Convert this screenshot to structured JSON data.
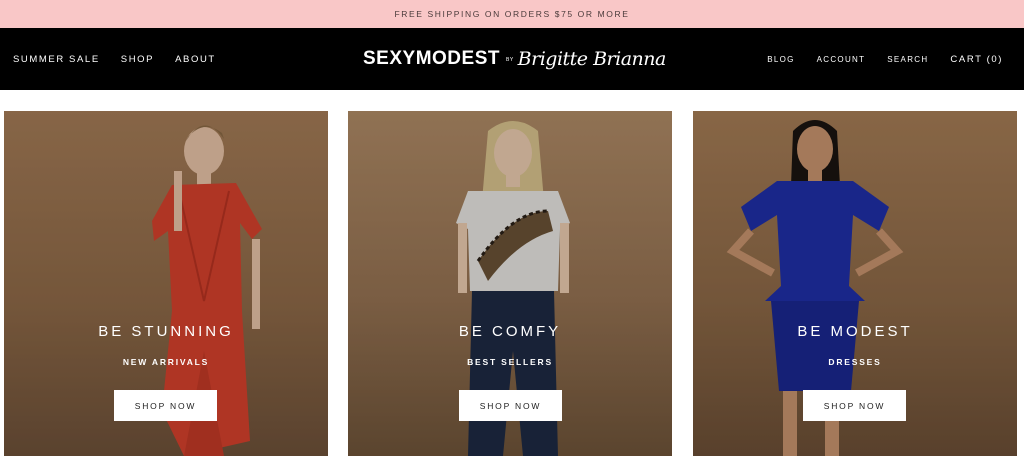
{
  "announcement": "FREE SHIPPING ON ORDERS $75 OR MORE",
  "nav_left": [
    {
      "label": "SUMMER SALE"
    },
    {
      "label": "SHOP"
    },
    {
      "label": "ABOUT"
    }
  ],
  "logo": {
    "wordmark": "SEXYMODEST",
    "by": "BY",
    "script": "Brigitte Brianna"
  },
  "nav_right": [
    {
      "label": "BLOG"
    },
    {
      "label": "ACCOUNT"
    },
    {
      "label": "SEARCH"
    },
    {
      "label": "CART (0)"
    }
  ],
  "cards": [
    {
      "title": "BE STUNNING",
      "subtitle": "NEW ARRIVALS",
      "button": "SHOP NOW",
      "garment_color": "#d6412d"
    },
    {
      "title": "BE COMFY",
      "subtitle": "BEST SELLERS",
      "button": "SHOP NOW",
      "garment_color": "#e8e6e2"
    },
    {
      "title": "BE MODEST",
      "subtitle": "DRESSES",
      "button": "SHOP NOW",
      "garment_color": "#1f2fa8"
    }
  ],
  "colors": {
    "announcement_bg": "#f9c7c7",
    "header_bg": "#000000"
  }
}
